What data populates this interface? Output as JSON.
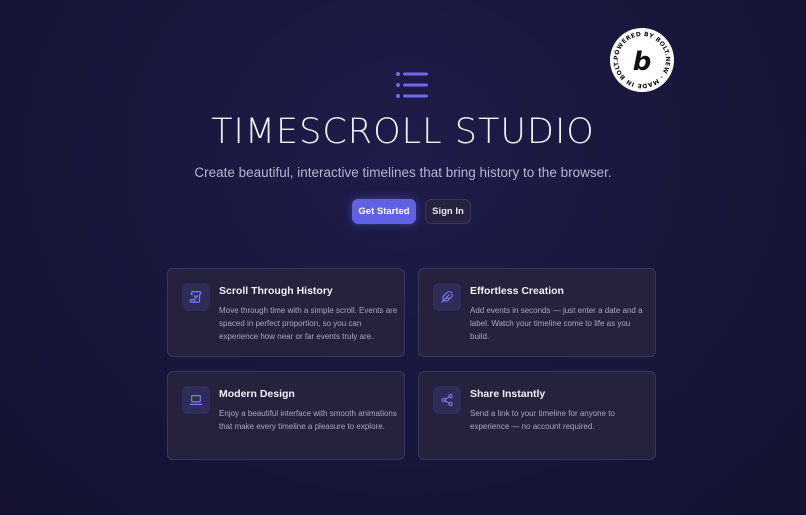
{
  "badge": {
    "text": "POWERED BY BOLT.NEW MADE IN BOLT.NEW",
    "letter": "b"
  },
  "hero": {
    "logo_icon": "list-icon",
    "title": "TIMESCROLL STUDIO",
    "subtitle": "Create beautiful, interactive timelines that bring history to the browser.",
    "primary_button": "Get Started",
    "secondary_button": "Sign In"
  },
  "features": [
    {
      "icon": "scroll-icon",
      "title": "Scroll Through History",
      "description": "Move through time with a simple scroll. Events are spaced in perfect proportion, so you can experience how near or far events truly are."
    },
    {
      "icon": "feather-icon",
      "title": "Effortless Creation",
      "description": "Add events in seconds — just enter a date and a label. Watch your timeline come to life as you build."
    },
    {
      "icon": "laptop-icon",
      "title": "Modern Design",
      "description": "Enjoy a beautiful interface with smooth animations that make every timeline a pleasure to explore."
    },
    {
      "icon": "share-icon",
      "title": "Share Instantly",
      "description": "Send a link to your timeline for anyone to experience — no account required."
    }
  ],
  "colors": {
    "accent": "#6161e6",
    "background": "#18163a",
    "card": "#24223d"
  }
}
